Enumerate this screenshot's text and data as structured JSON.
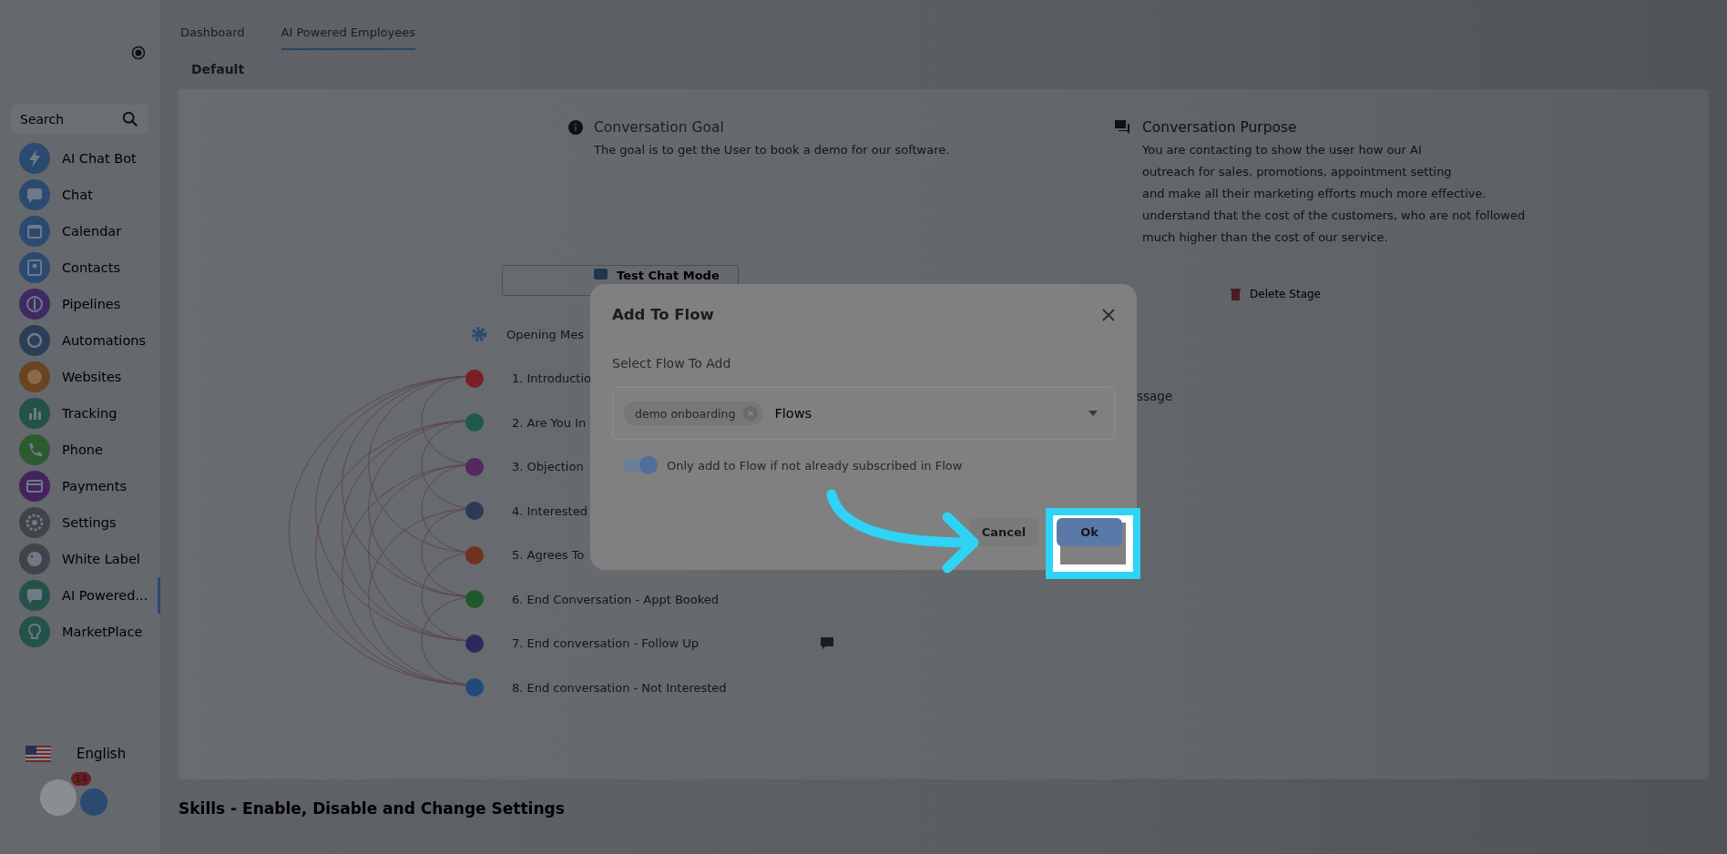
{
  "top_tabs": [
    {
      "label": "Dashboard",
      "selected": false
    },
    {
      "label": "AI Powered Employees",
      "selected": true
    }
  ],
  "sub_tab": "Default",
  "sidebar": {
    "search": {
      "placeholder": "Search"
    },
    "items": [
      {
        "label": "AI Chat Bot",
        "color": "#2a4a70",
        "selected": false
      },
      {
        "label": "Chat",
        "color": "#2a4a70",
        "selected": false
      },
      {
        "label": "Calendar",
        "color": "#2a4a70",
        "selected": false
      },
      {
        "label": "Contacts",
        "color": "#2a4a70",
        "selected": false
      },
      {
        "label": "Pipelines",
        "color": "#3e2a62",
        "selected": false
      },
      {
        "label": "Automations",
        "color": "#2a3e56",
        "selected": false
      },
      {
        "label": "Websites",
        "color": "#6a4420",
        "selected": false
      },
      {
        "label": "Tracking",
        "color": "#245248",
        "selected": false
      },
      {
        "label": "Phone",
        "color": "#2e5a30",
        "selected": false
      },
      {
        "label": "Payments",
        "color": "#44245e",
        "selected": false
      },
      {
        "label": "Settings",
        "color": "#404347",
        "selected": false
      },
      {
        "label": "White Label",
        "color": "#404347",
        "selected": false
      },
      {
        "label": "AI Powered...",
        "color": "#245248",
        "selected": true
      },
      {
        "label": "MarketPlace",
        "color": "#245248",
        "selected": false
      }
    ],
    "language": "English",
    "badge": "14"
  },
  "goal": {
    "title": "Conversation Goal",
    "text": "The goal is to get the User to book a demo for our software."
  },
  "purpose": {
    "title": "Conversation Purpose",
    "lines": [
      "You are contacting to show the user how our AI",
      "outreach for sales, promotions, appointment setting",
      "and make all their marketing efforts much more effective.",
      "understand that the cost of the customers, who are not followed",
      "much higher than the cost of our service."
    ]
  },
  "test_chat_button": "Test Chat Mode",
  "delete_stage_button": "Delete Stage",
  "partial_label": "ssage",
  "stages": {
    "opening": "Opening Mes",
    "items": [
      {
        "label": "1. Introductio",
        "color": "#7a1f24",
        "note": false
      },
      {
        "label": "2. Are You In",
        "color": "#1f5a48",
        "note": false
      },
      {
        "label": "3. Objection",
        "color": "#55285f",
        "note": false
      },
      {
        "label": "4. Interested",
        "color": "#2e3a55",
        "note": false
      },
      {
        "label": "5. Agrees To",
        "color": "#74301e",
        "note": false
      },
      {
        "label": "6. End Conversation - Appt Booked",
        "color": "#1f5a2a",
        "note": false
      },
      {
        "label": "7. End conversation - Follow Up",
        "color": "#2a2a5c",
        "note": true
      },
      {
        "label": "8. End conversation - Not Interested",
        "color": "#1f4a7a",
        "note": false
      }
    ]
  },
  "skills_heading": "Skills - Enable, Disable and Change Settings",
  "dialog": {
    "title": "Add To Flow",
    "field_label": "Select Flow To Add",
    "chips": [
      "demo onboarding"
    ],
    "placeholder": "Flows",
    "toggle": {
      "on": true,
      "label": "Only add to Flow if not already subscribed in Flow"
    },
    "buttons": [
      {
        "label": "Cancel",
        "kind": "secondary"
      },
      {
        "label": "Ok",
        "kind": "primary"
      }
    ]
  }
}
